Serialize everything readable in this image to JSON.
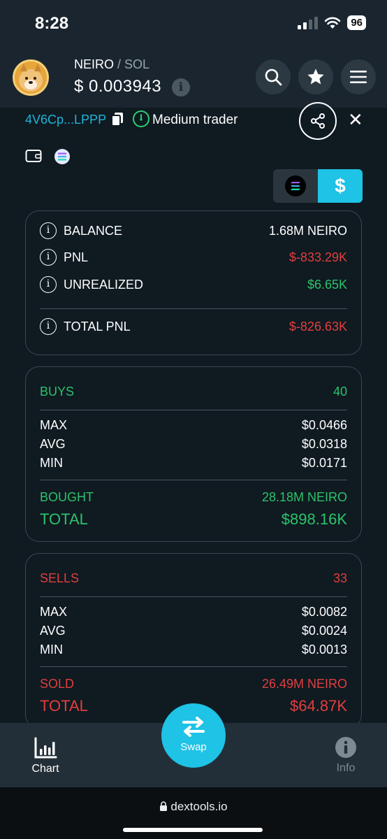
{
  "status_bar": {
    "time": "8:28",
    "battery": "96"
  },
  "header": {
    "pair_base": "NEIRO",
    "pair_sep": " / ",
    "pair_quote": "SOL",
    "price": "$ 0.003943",
    "info_glyph": "i"
  },
  "trader": {
    "wallet": "4V6Cp...LPPP",
    "type_label": "Medium trader",
    "close_glyph": "✕"
  },
  "currency_toggle": {
    "usd_label": "$",
    "selected": "usd"
  },
  "summary": {
    "balance_label": "BALANCE",
    "balance_value": "1.68M NEIRO",
    "pnl_label": "PNL",
    "pnl_value": "$-833.29K",
    "unrealized_label": "UNREALIZED",
    "unrealized_value": "$6.65K",
    "total_pnl_label": "TOTAL PNL",
    "total_pnl_value": "$-826.63K"
  },
  "buys": {
    "label": "BUYS",
    "count": "40",
    "max_label": "MAX",
    "max": "$0.0466",
    "avg_label": "AVG",
    "avg": "$0.0318",
    "min_label": "MIN",
    "min": "$0.0171",
    "bought_label": "BOUGHT",
    "bought": "28.18M NEIRO",
    "total_label": "TOTAL",
    "total": "$898.16K"
  },
  "sells": {
    "label": "SELLS",
    "count": "33",
    "max_label": "MAX",
    "max": "$0.0082",
    "avg_label": "AVG",
    "avg": "$0.0024",
    "min_label": "MIN",
    "min": "$0.0013",
    "sold_label": "SOLD",
    "sold": "26.49M NEIRO",
    "total_label": "TOTAL",
    "total": "$64.87K"
  },
  "bottom_nav": {
    "chart_label": "Chart",
    "swap_label": "Swap",
    "info_label": "Info"
  },
  "browser": {
    "url": "dextools.io"
  },
  "colors": {
    "accent": "#1ec3e6",
    "positive": "#2cc36a",
    "negative": "#e23e3e",
    "background": "#0f1a21"
  }
}
